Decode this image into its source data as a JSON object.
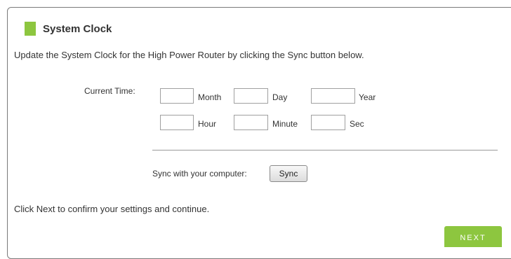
{
  "section": {
    "title": "System Clock",
    "title_marker_color": "#8dc63f"
  },
  "description": "Update the System Clock for the High Power Router by clicking the Sync button below.",
  "clock": {
    "current_time_label": "Current Time:",
    "fields": {
      "month": {
        "label": "Month",
        "value": ""
      },
      "day": {
        "label": "Day",
        "value": ""
      },
      "year": {
        "label": "Year",
        "value": ""
      },
      "hour": {
        "label": "Hour",
        "value": ""
      },
      "minute": {
        "label": "Minute",
        "value": ""
      },
      "sec": {
        "label": "Sec",
        "value": ""
      }
    }
  },
  "sync": {
    "label": "Sync with your computer:",
    "button_label": "Sync"
  },
  "footer": {
    "text": "Click Next to confirm your settings and continue.",
    "next_button_label": "NEXT",
    "next_button_color": "#8dc63f"
  }
}
